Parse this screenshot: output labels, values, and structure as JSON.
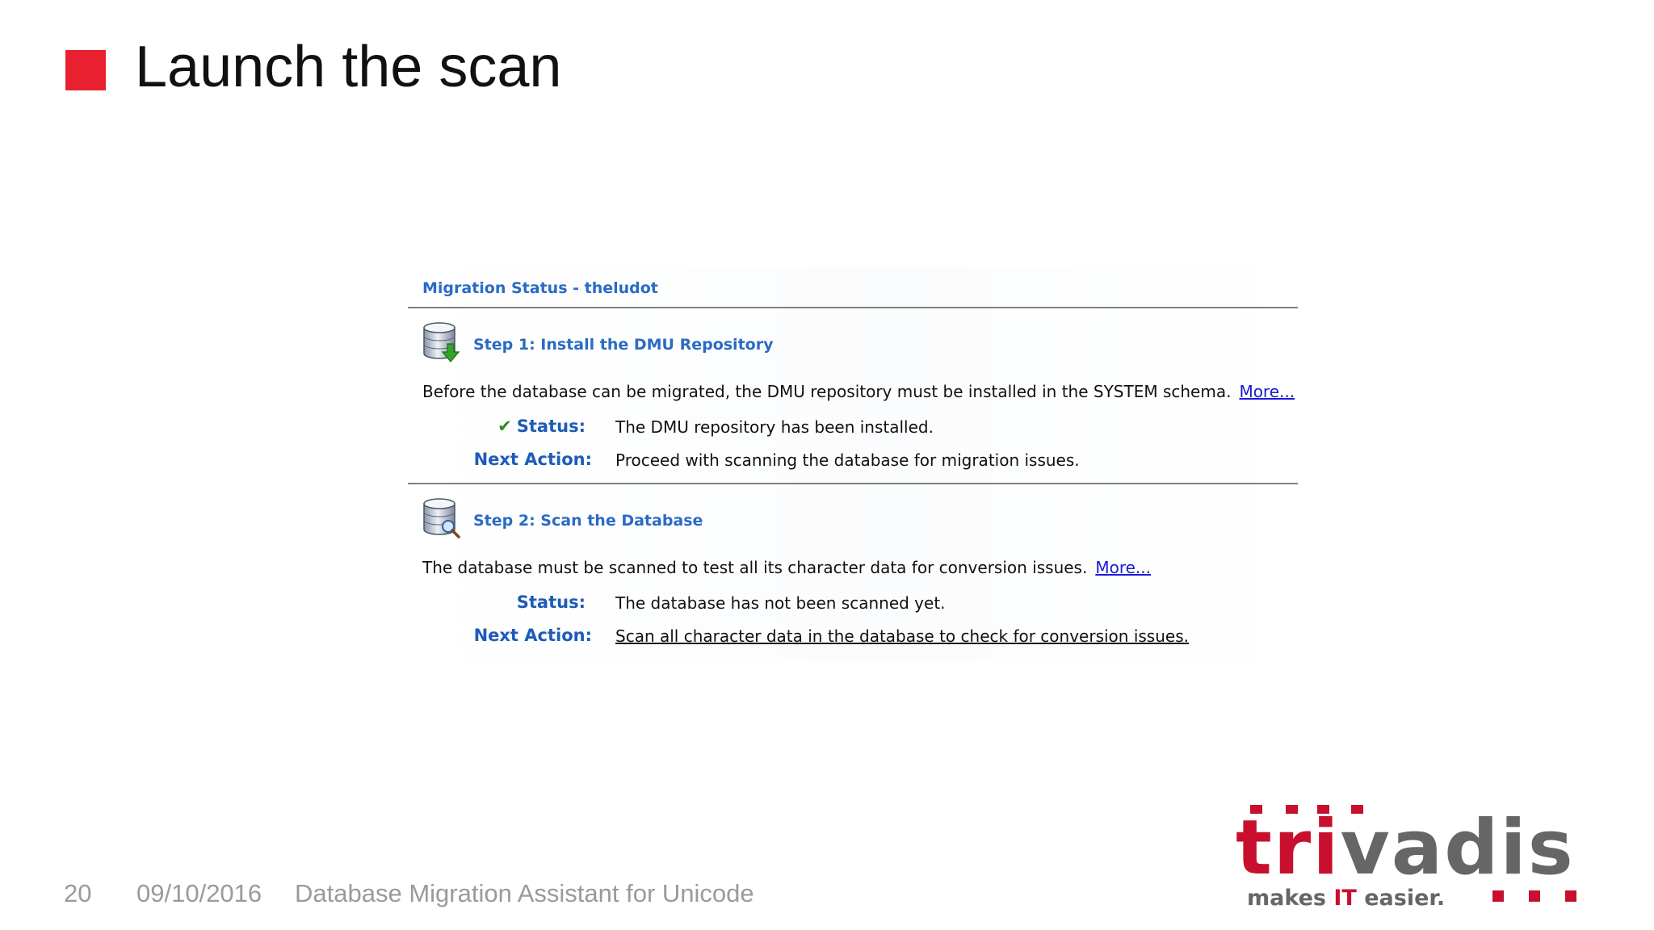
{
  "slide": {
    "title": "Launch the scan",
    "footer": {
      "page_number": "20",
      "date": "09/10/2016",
      "subject": "Database Migration Assistant for Unicode"
    },
    "logo": {
      "wordmark": "trivadis",
      "tagline_prefix": "makes ",
      "tagline_highlight": "IT",
      "tagline_suffix": " easier."
    }
  },
  "migration_status": {
    "header": "Migration Status - theludot",
    "steps": [
      {
        "title": "Step 1: Install the DMU Repository",
        "icon": "database-download-icon",
        "description": "Before the database can be migrated, the DMU repository must be installed in the SYSTEM schema.",
        "more_link": "More...",
        "status_label": "Status:",
        "status_value": "The DMU repository has been installed.",
        "status_icon": "check-icon",
        "next_action_label": "Next Action:",
        "next_action_value": "Proceed with scanning the database for migration issues."
      },
      {
        "title": "Step 2: Scan the Database",
        "icon": "database-search-icon",
        "description": "The database must be scanned to test all its character data for conversion issues.",
        "more_link": "More...",
        "status_label": "Status:",
        "status_value": "The database has not been scanned yet.",
        "next_action_label": "Next Action:",
        "next_action_link": "Scan all character data in the database to check for conversion issues."
      }
    ]
  },
  "colors": {
    "accent_red": "#e8202f",
    "header_blue": "#2a6bc4",
    "label_blue": "#1e5bb8",
    "link_blue": "#1a1ad6",
    "logo_gray": "#666666"
  }
}
